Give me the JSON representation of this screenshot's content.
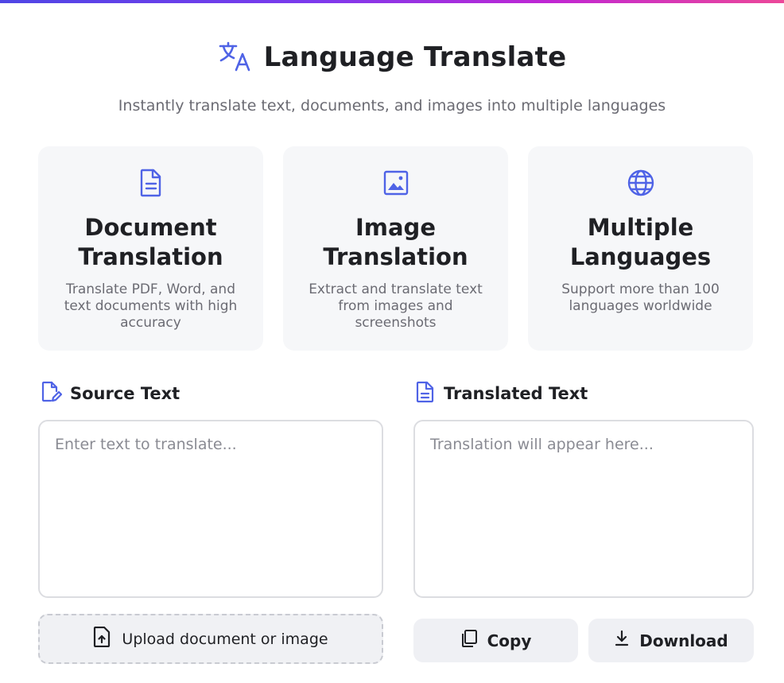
{
  "header": {
    "title": "Language Translate",
    "subtitle": "Instantly translate text, documents, and images into multiple languages",
    "logo_icon": "translate-icon"
  },
  "features": [
    {
      "icon": "document-icon",
      "title": "Document Translation",
      "description": "Translate PDF, Word, and text documents with high accuracy"
    },
    {
      "icon": "image-icon",
      "title": "Image Translation",
      "description": "Extract and translate text from images and screenshots"
    },
    {
      "icon": "globe-icon",
      "title": "Multiple Languages",
      "description": "Support more than 100 languages worldwide"
    }
  ],
  "source": {
    "heading": "Source Text",
    "placeholder": "Enter text to translate...",
    "upload_label": "Upload document or image"
  },
  "target": {
    "heading": "Translated Text",
    "placeholder": "Translation will appear here...",
    "copy_label": "Copy",
    "download_label": "Download"
  },
  "colors": {
    "accent": "#4f63e6",
    "card_bg": "#f6f7f9",
    "button_bg": "#eff0f4"
  }
}
